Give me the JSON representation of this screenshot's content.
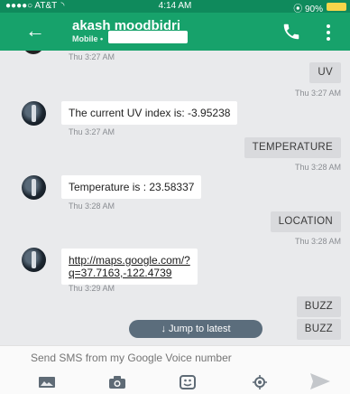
{
  "status_bar": {
    "carrier": "●●●●○ AT&T  ◝",
    "time": "4:14 AM",
    "battery": "⦿ 90%"
  },
  "header": {
    "contact_name": "akash moodbidri",
    "contact_sub": "Mobile •",
    "icons": [
      "back-arrow-icon",
      "phone-icon",
      "more-vert-icon"
    ]
  },
  "messages": [
    {
      "type": "timestamp",
      "side": "left",
      "text": "Thu 3:27 AM"
    },
    {
      "type": "outgoing",
      "text": "UV"
    },
    {
      "type": "timestamp",
      "side": "right",
      "text": "Thu 3:27 AM"
    },
    {
      "type": "incoming",
      "text": "The current UV index is: -3.95238"
    },
    {
      "type": "timestamp",
      "side": "left",
      "text": "Thu 3:27 AM"
    },
    {
      "type": "outgoing",
      "text": "TEMPERATURE"
    },
    {
      "type": "timestamp",
      "side": "right",
      "text": "Thu 3:28 AM"
    },
    {
      "type": "incoming",
      "text": "Temperature is : 23.58337"
    },
    {
      "type": "timestamp",
      "side": "left",
      "text": "Thu 3:28 AM"
    },
    {
      "type": "outgoing",
      "text": "LOCATION"
    },
    {
      "type": "timestamp",
      "side": "right",
      "text": "Thu 3:28 AM"
    },
    {
      "type": "incoming_link",
      "line1": "http://maps.google.com/?",
      "line2": "q=37.7163,-122.4739"
    },
    {
      "type": "timestamp",
      "side": "left",
      "text": "Thu 3:29 AM"
    },
    {
      "type": "outgoing",
      "text": "BUZZ"
    },
    {
      "type": "outgoing",
      "text": "BUZZ"
    }
  ],
  "jump_button": {
    "label": "↓ Jump to latest"
  },
  "composer": {
    "placeholder": "Send SMS from my Google Voice number",
    "value": "",
    "tools": [
      "image-icon",
      "camera-icon",
      "sticker-icon",
      "location-icon"
    ],
    "send_icon": "send-icon"
  },
  "colors": {
    "status_bar": "#0f8a5c",
    "app_bar": "#17a26b",
    "background": "#e9eaec",
    "outgoing_bubble": "#d9dadd",
    "incoming_bubble": "#ffffff",
    "jump_button": "#5b6d7c"
  }
}
